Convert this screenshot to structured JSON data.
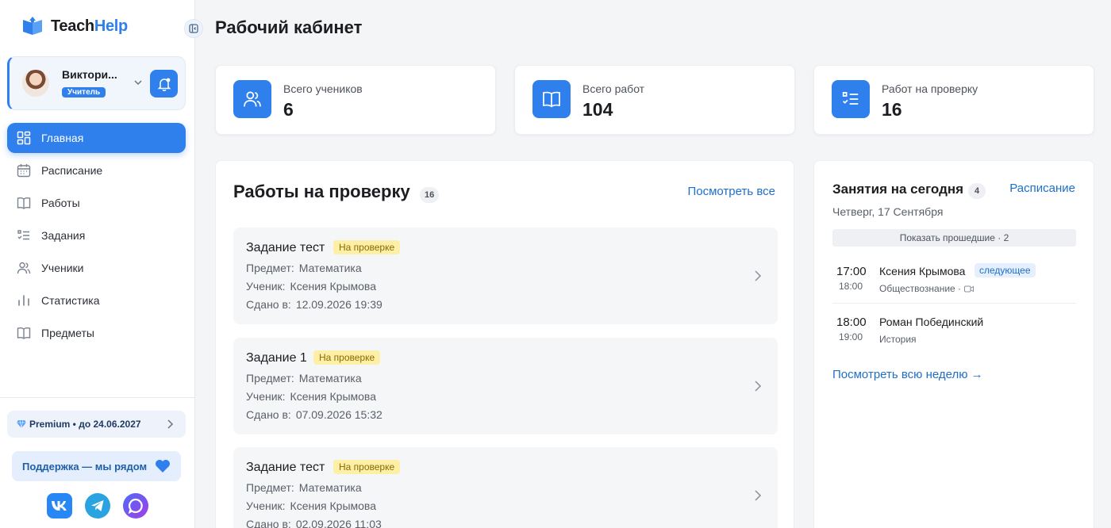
{
  "brand": {
    "name_part1": "Teach",
    "name_part2": "Help"
  },
  "profile": {
    "name": "Виктори...",
    "role": "Учитель"
  },
  "nav": [
    {
      "label": "Главная",
      "icon": "grid-icon",
      "active": true
    },
    {
      "label": "Расписание",
      "icon": "calendar-icon",
      "active": false
    },
    {
      "label": "Работы",
      "icon": "book-icon",
      "active": false
    },
    {
      "label": "Задания",
      "icon": "checklist-icon",
      "active": false
    },
    {
      "label": "Ученики",
      "icon": "users-icon",
      "active": false
    },
    {
      "label": "Статистика",
      "icon": "bar-chart-icon",
      "active": false
    },
    {
      "label": "Предметы",
      "icon": "book-icon",
      "active": false
    }
  ],
  "premium": {
    "label": "Premium • до 24.06.2027"
  },
  "support": {
    "label": "Поддержка — мы рядом"
  },
  "page_title": "Рабочий кабинет",
  "stats": [
    {
      "label": "Всего учеников",
      "value": "6",
      "icon": "users-icon"
    },
    {
      "label": "Всего работ",
      "value": "104",
      "icon": "book-icon"
    },
    {
      "label": "Работ на проверку",
      "value": "16",
      "icon": "checklist-icon"
    }
  ],
  "review": {
    "title": "Работы на проверку",
    "count": "16",
    "see_all": "Посмотреть все",
    "subject_label": "Предмет:",
    "student_label": "Ученик:",
    "submitted_label": "Сдано в:",
    "items": [
      {
        "title": "Задание тест",
        "status": "На проверке",
        "subject": "Математика",
        "student": "Ксения Крымова",
        "submitted": "12.09.2026 19:39"
      },
      {
        "title": "Задание 1",
        "status": "На проверке",
        "subject": "Математика",
        "student": "Ксения Крымова",
        "submitted": "07.09.2026 15:32"
      },
      {
        "title": "Задание тест",
        "status": "На проверке",
        "subject": "Математика",
        "student": "Ксения Крымова",
        "submitted": "02.09.2026 11:03"
      }
    ]
  },
  "today": {
    "title": "Занятия на сегодня",
    "count": "4",
    "schedule_link": "Расписание",
    "date": "Четверг, 17 Сентября",
    "show_past": "Показать прошедшие · 2",
    "lessons": [
      {
        "start": "17:00",
        "end": "18:00",
        "student": "Ксения Крымова",
        "tag": "следующее",
        "subject": "Обществознание ·"
      },
      {
        "start": "18:00",
        "end": "19:00",
        "student": "Роман Побединский",
        "tag": "",
        "subject": "История"
      }
    ],
    "week_link": "Посмотреть всю неделю →"
  },
  "colors": {
    "accent": "#2f80ed",
    "status_bg": "#fdf0a6",
    "link": "#1f6fc7"
  }
}
